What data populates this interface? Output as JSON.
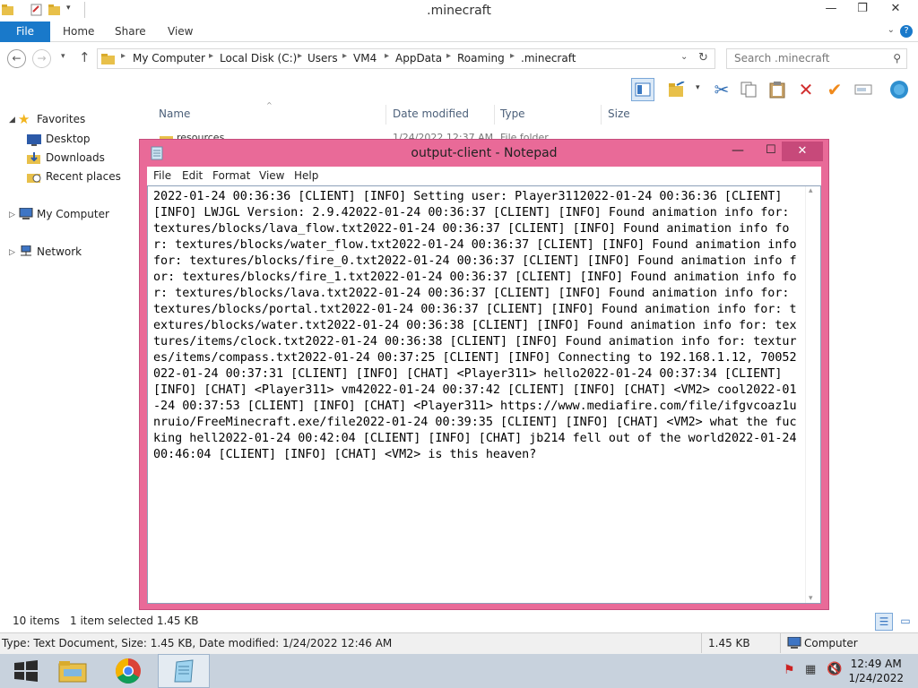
{
  "explorer": {
    "title": ".minecraft",
    "ribbon_tabs": {
      "file": "File",
      "home": "Home",
      "share": "Share",
      "view": "View"
    },
    "address": [
      "My Computer",
      "Local Disk (C:)",
      "Users",
      "VM4",
      "AppData",
      "Roaming",
      ".minecraft"
    ],
    "search_placeholder": "Search .minecraft",
    "nav_pane": {
      "favorites": "Favorites",
      "desktop": "Desktop",
      "downloads": "Downloads",
      "recent": "Recent places",
      "computer": "My Computer",
      "network": "Network"
    },
    "columns": {
      "name": "Name",
      "date": "Date modified",
      "type": "Type",
      "size": "Size"
    },
    "visible_row": {
      "name": "resources",
      "date": "1/24/2022 12:37 AM",
      "type": "File folder"
    },
    "status": {
      "items": "10 items",
      "selected": "1 item selected  1.45 KB"
    },
    "details": {
      "info": "Type: Text Document, Size: 1.45 KB, Date modified: 1/24/2022 12:46 AM",
      "size": "1.45 KB",
      "location": "Computer"
    }
  },
  "notepad": {
    "title": "output-client - Notepad",
    "menu": [
      "File",
      "Edit",
      "Format",
      "View",
      "Help"
    ],
    "content": "2022-01-24 00:36:36 [CLIENT] [INFO] Setting user: Player3112022-01-24 00:36:36 [CLIENT] [INFO] LWJGL Version: 2.9.42022-01-24 00:36:37 [CLIENT] [INFO] Found animation info for: textures/blocks/lava_flow.txt2022-01-24 00:36:37 [CLIENT] [INFO] Found animation info for: textures/blocks/water_flow.txt2022-01-24 00:36:37 [CLIENT] [INFO] Found animation info for: textures/blocks/fire_0.txt2022-01-24 00:36:37 [CLIENT] [INFO] Found animation info for: textures/blocks/fire_1.txt2022-01-24 00:36:37 [CLIENT] [INFO] Found animation info for: textures/blocks/lava.txt2022-01-24 00:36:37 [CLIENT] [INFO] Found animation info for: textures/blocks/portal.txt2022-01-24 00:36:37 [CLIENT] [INFO] Found animation info for: textures/blocks/water.txt2022-01-24 00:36:38 [CLIENT] [INFO] Found animation info for: textures/items/clock.txt2022-01-24 00:36:38 [CLIENT] [INFO] Found animation info for: textures/items/compass.txt2022-01-24 00:37:25 [CLIENT] [INFO] Connecting to 192.168.1.12, 70052022-01-24 00:37:31 [CLIENT] [INFO] [CHAT] <Player311> hello2022-01-24 00:37:34 [CLIENT] [INFO] [CHAT] <Player311> vm42022-01-24 00:37:42 [CLIENT] [INFO] [CHAT] <VM2> cool2022-01-24 00:37:53 [CLIENT] [INFO] [CHAT] <Player311> https://www.mediafire.com/file/ifgvcoaz1unruio/FreeMinecraft.exe/file2022-01-24 00:39:35 [CLIENT] [INFO] [CHAT] <VM2> what the fucking hell2022-01-24 00:42:04 [CLIENT] [INFO] [CHAT] jb214 fell out of the world2022-01-24 00:46:04 [CLIENT] [INFO] [CHAT] <VM2> is this heaven?"
  },
  "taskbar": {
    "time": "12:49 AM",
    "date": "1/24/2022"
  },
  "colors": {
    "notepad_frame": "#e96a98",
    "file_tab": "#1979ca",
    "taskbar": "#c8d2dd"
  }
}
